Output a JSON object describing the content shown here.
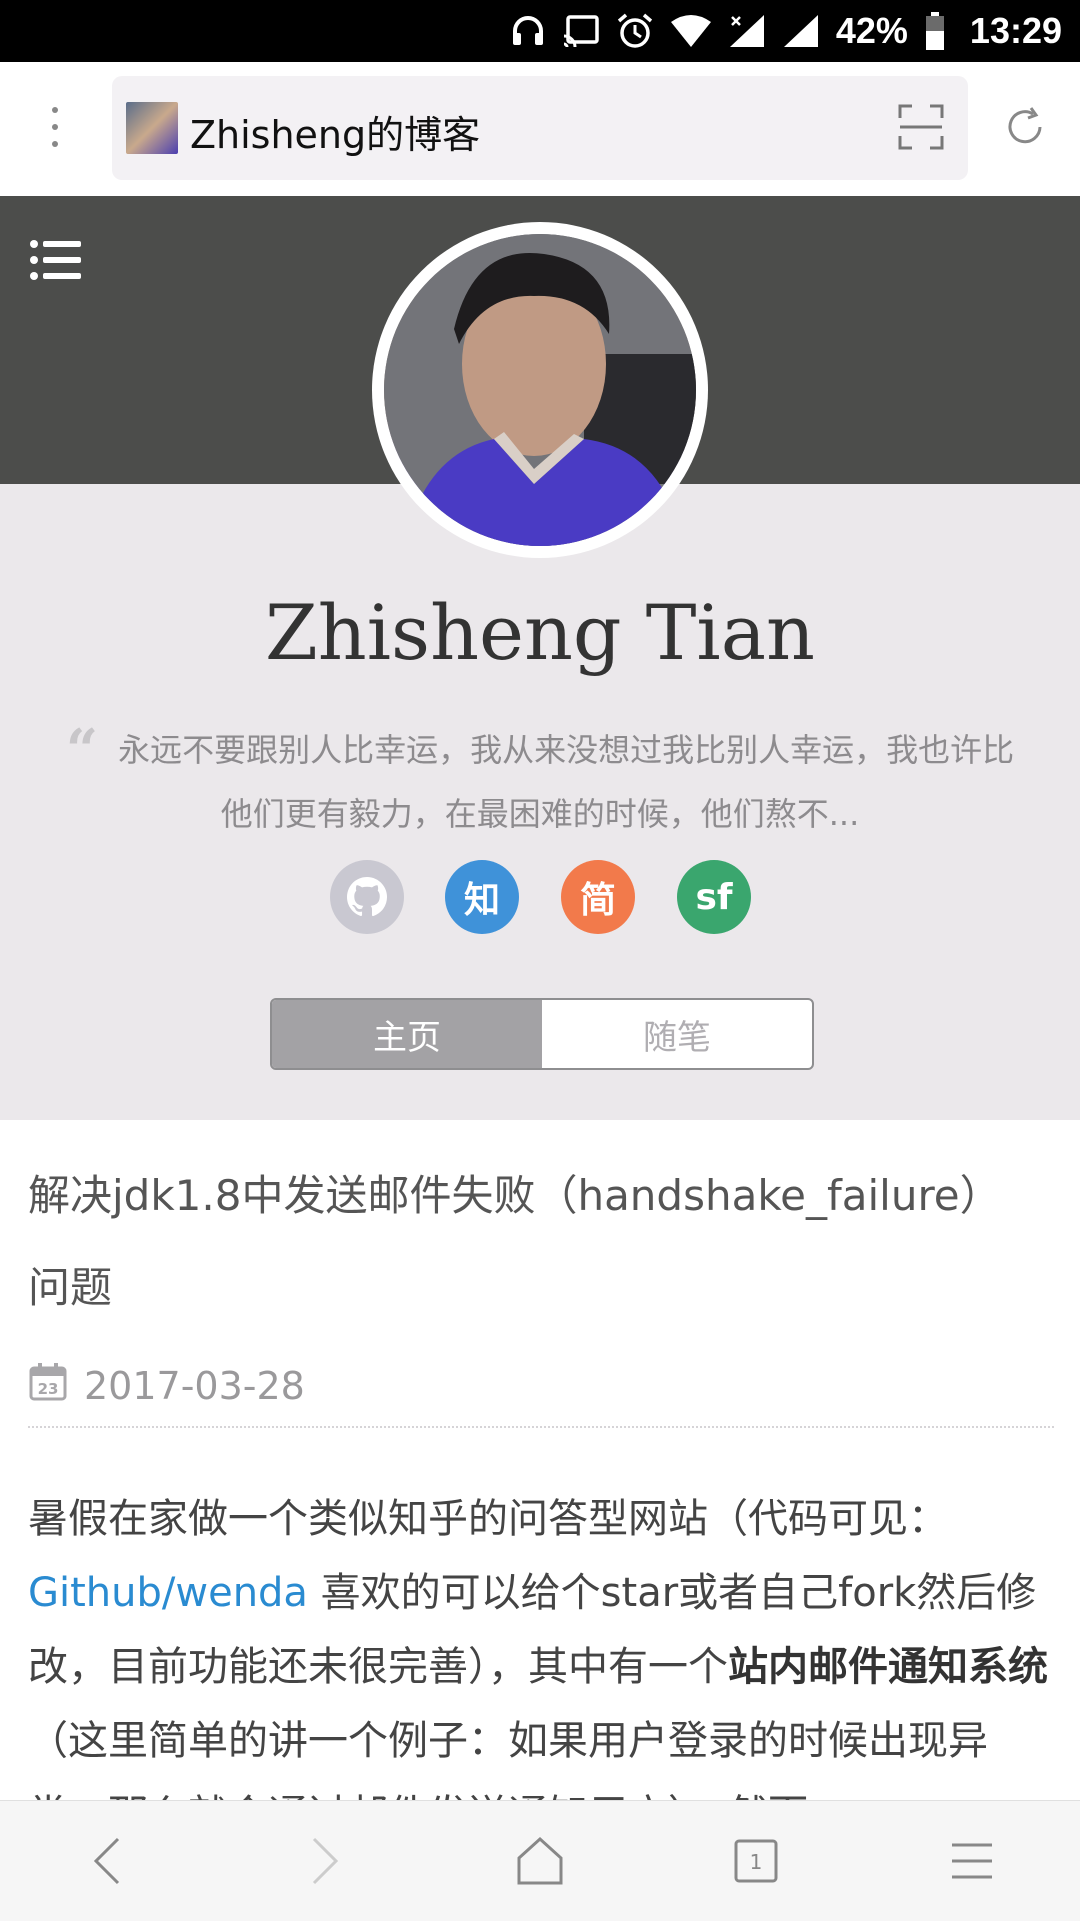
{
  "status_bar": {
    "battery": "42%",
    "time": "13:29",
    "icons": [
      "headphones-icon",
      "cast-icon",
      "alarm-icon",
      "wifi-icon",
      "signal-icon",
      "signal-icon",
      "battery-icon"
    ]
  },
  "browser": {
    "page_title": "Zhisheng的博客"
  },
  "profile": {
    "name": "Zhisheng Tian",
    "quote": "永远不要跟别人比幸运，我从来没想过我比别人幸运，我也许比他们更有毅力，在最困难的时候，他们熬不...",
    "socials": [
      {
        "name": "github",
        "label": "",
        "color": "#c9c8d1"
      },
      {
        "name": "zhihu",
        "label": "知",
        "color": "#3f92d9"
      },
      {
        "name": "jianshu",
        "label": "简",
        "color": "#f27a4b"
      },
      {
        "name": "segmentfault",
        "label": "sf",
        "color": "#3aa66e"
      }
    ],
    "tabs": [
      {
        "label": "主页",
        "active": true
      },
      {
        "label": "随笔",
        "active": false
      }
    ]
  },
  "post": {
    "title": "解决jdk1.8中发送邮件失败（handshake_failure）问题",
    "date": "2017-03-28",
    "calendar_day": "23",
    "body": {
      "intro": "暑假在家做一个类似知乎的问答型网站（代码可见：",
      "link": "Github/wenda",
      "middle": " 喜欢的可以给个star或者自己fork然后修改，目前功能还未很完善），其中有一个",
      "bold": "站内邮件通知系统",
      "tail": "（这里简单的讲一个例子：如果用户登录的时候出现异常，那么就会通过邮件发送通知用户），然而"
    }
  },
  "bottom_nav": {
    "tab_count": "1"
  }
}
